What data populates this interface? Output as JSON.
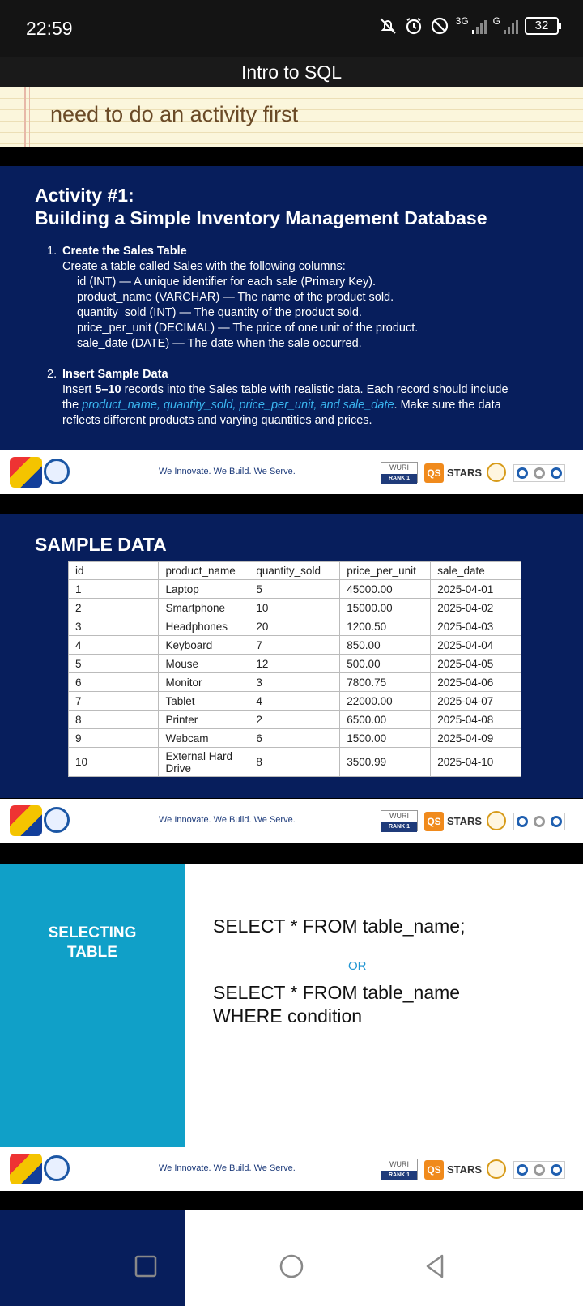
{
  "status": {
    "time": "22:59",
    "net1": "3G",
    "net2": "G",
    "battery": "32"
  },
  "app": {
    "title": "Intro to SQL"
  },
  "note": {
    "text": "need to do an activity first"
  },
  "activity": {
    "title_line1": "Activity #1:",
    "title_line2": "Building a Simple Inventory Management Database",
    "item1": {
      "num": "1.",
      "head": "Create the Sales Table",
      "intro": "Create a table called Sales with the following columns:",
      "cols": [
        "id (INT) — A unique identifier for each sale (Primary Key).",
        "product_name (VARCHAR) — The name of the product sold.",
        "quantity_sold (INT) — The quantity of the product sold.",
        "price_per_unit (DECIMAL) — The price of one unit of the product.",
        "sale_date (DATE) — The date when the sale occurred."
      ]
    },
    "item2": {
      "num": "2.",
      "head": "Insert Sample Data",
      "l1a": "Insert ",
      "l1b": "5–10",
      "l1c": " records into the Sales table with realistic data. Each record should include",
      "l2a": "the ",
      "l2b": "product_name, quantity_sold, price_per_unit, and sale_date",
      "l2c": ". Make sure the data",
      "l3": "reflects different products and varying quantities and prices."
    }
  },
  "footer": {
    "tagline": "We Innovate. We Build. We Serve.",
    "wurl": "WURI",
    "wurl_rank": "RANK 1",
    "qs": "QS",
    "stars": "STARS"
  },
  "sample": {
    "title": "SAMPLE DATA",
    "headers": [
      "id",
      "product_name",
      "quantity_sold",
      "price_per_unit",
      "sale_date"
    ],
    "rows": [
      [
        "1",
        "Laptop",
        "5",
        "45000.00",
        "2025-04-01"
      ],
      [
        "2",
        "Smartphone",
        "10",
        "15000.00",
        "2025-04-02"
      ],
      [
        "3",
        "Headphones",
        "20",
        "1200.50",
        "2025-04-03"
      ],
      [
        "4",
        "Keyboard",
        "7",
        "850.00",
        "2025-04-04"
      ],
      [
        "5",
        "Mouse",
        "12",
        "500.00",
        "2025-04-05"
      ],
      [
        "6",
        "Monitor",
        "3",
        "7800.75",
        "2025-04-06"
      ],
      [
        "7",
        "Tablet",
        "4",
        "22000.00",
        "2025-04-07"
      ],
      [
        "8",
        "Printer",
        "2",
        "6500.00",
        "2025-04-08"
      ],
      [
        "9",
        "Webcam",
        "6",
        "1500.00",
        "2025-04-09"
      ],
      [
        "10",
        "External Hard Drive",
        "8",
        "3500.99",
        "2025-04-10"
      ]
    ]
  },
  "selecting": {
    "label_line1": "SELECTING",
    "label_line2": "TABLE",
    "query1": "SELECT * FROM table_name;",
    "or": "OR",
    "query2_line1": "SELECT * FROM table_name",
    "query2_line2": "WHERE condition"
  },
  "icons": [
    "mute-bell-icon",
    "alarm-icon",
    "do-not-disturb-icon",
    "signal-icon",
    "battery-icon",
    "recent-apps-icon",
    "home-icon",
    "back-icon"
  ]
}
